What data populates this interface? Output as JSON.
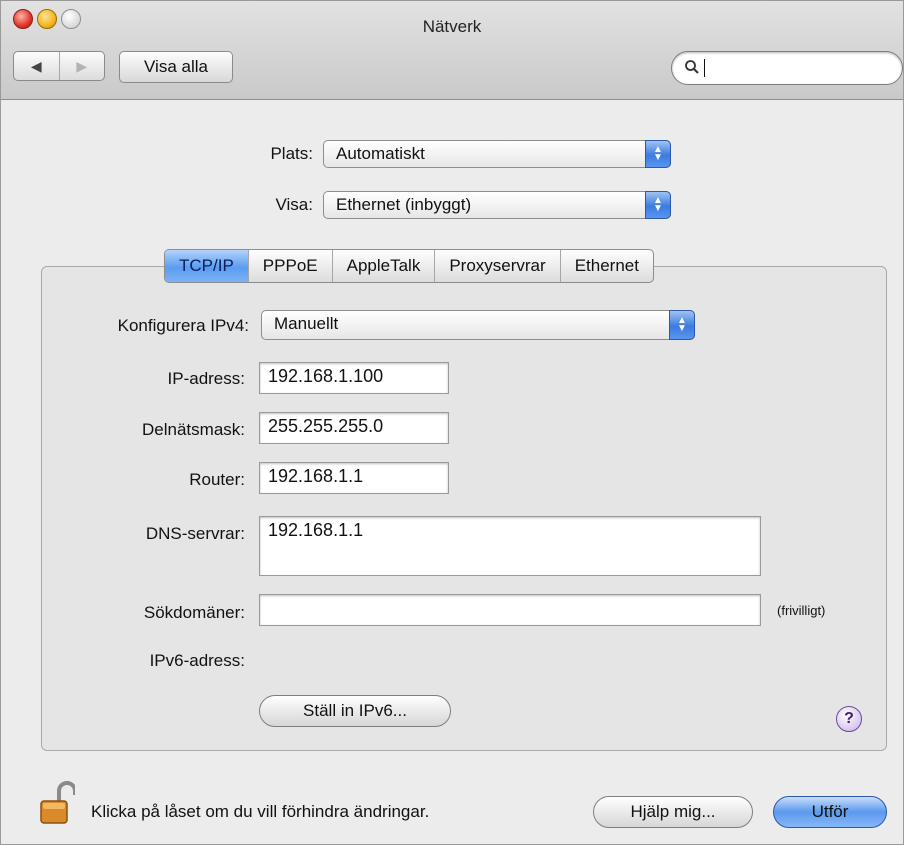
{
  "window": {
    "title": "Nätverk"
  },
  "toolbar": {
    "back_glyph": "◀",
    "forward_glyph": "▶",
    "show_all": "Visa alla",
    "search_value": ""
  },
  "location": {
    "label": "Plats:",
    "value": "Automatiskt"
  },
  "show": {
    "label": "Visa:",
    "value": "Ethernet (inbyggt)"
  },
  "tabs": [
    {
      "label": "TCP/IP",
      "active": true
    },
    {
      "label": "PPPoE"
    },
    {
      "label": "AppleTalk"
    },
    {
      "label": "Proxyservrar"
    },
    {
      "label": "Ethernet"
    }
  ],
  "tcpip": {
    "configure_label": "Konfigurera IPv4:",
    "configure_value": "Manuellt",
    "ip_label": "IP-adress:",
    "ip_value": "192.168.1.100",
    "subnet_label": "Delnätsmask:",
    "subnet_value": "255.255.255.0",
    "router_label": "Router:",
    "router_value": "192.168.1.1",
    "dns_label": "DNS-servrar:",
    "dns_value": "192.168.1.1",
    "search_domains_label": "Sökdomäner:",
    "search_domains_value": "",
    "optional_note": "(frivilligt)",
    "ipv6_label": "IPv6-adress:",
    "ipv6_button": "Ställ in IPv6...",
    "help_glyph": "?"
  },
  "footer": {
    "lock_text": "Klicka på låset om du vill förhindra ändringar.",
    "assist_button": "Hjälp mig...",
    "apply_button": "Utför"
  },
  "colors": {
    "accent": "#5b99ee",
    "window_bg": "#ececec"
  },
  "icons": {
    "lock": "padlock-open-icon",
    "search": "magnifier-icon",
    "help": "question-icon"
  }
}
